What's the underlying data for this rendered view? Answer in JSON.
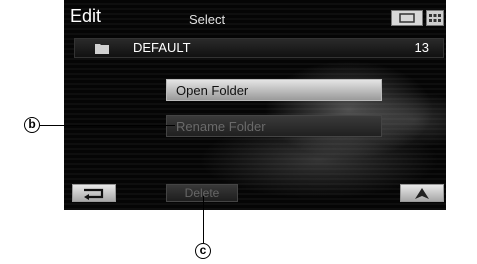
{
  "header": {
    "title": "Edit",
    "mode": "Select",
    "view_buttons": [
      "single-view-icon",
      "grid-view-icon"
    ]
  },
  "folder": {
    "name": "DEFAULT",
    "count": "13"
  },
  "menu": {
    "open_label": "Open Folder",
    "rename_label": "Rename Folder"
  },
  "bottom": {
    "delete_label": "Delete"
  },
  "callouts": {
    "b": "b",
    "c": "c"
  }
}
